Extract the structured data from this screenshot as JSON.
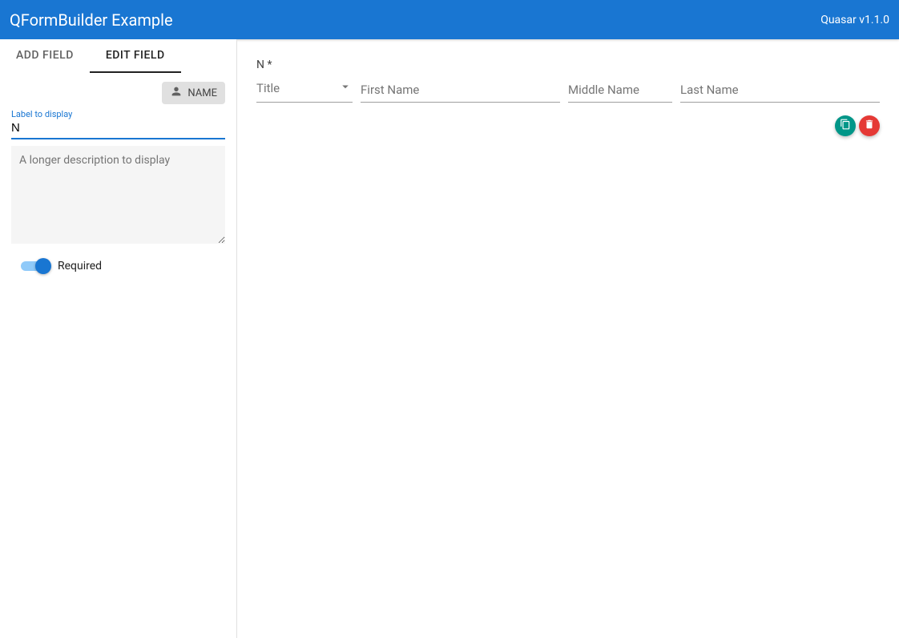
{
  "header": {
    "title": "QFormBuilder Example",
    "version": "Quasar v1.1.0"
  },
  "sidebar": {
    "tabs": {
      "add": "ADD FIELD",
      "edit": "EDIT FIELD"
    },
    "chip": {
      "label": "NAME",
      "icon": "person-icon"
    },
    "label_field": {
      "floating": "Label to display",
      "value": "N"
    },
    "description": {
      "placeholder": "A longer description to display",
      "value": ""
    },
    "required": {
      "label": "Required",
      "on": true
    }
  },
  "preview": {
    "field_label": "N *",
    "title_placeholder": "Title",
    "first_name_placeholder": "First Name",
    "middle_name_placeholder": "Middle Name",
    "last_name_placeholder": "Last Name"
  },
  "actions": {
    "copy_icon": "copy-icon",
    "delete_icon": "trash-icon"
  }
}
